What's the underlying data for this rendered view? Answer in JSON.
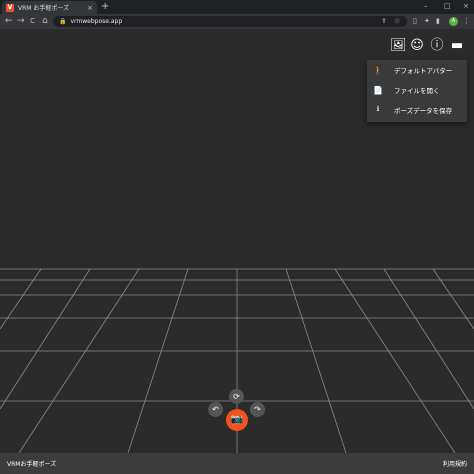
{
  "browser": {
    "tab_title": "VRM お手軽ポーズ",
    "favicon_letter": "V",
    "tab_close": "×",
    "new_tab": "+",
    "window_controls": [
      "–",
      "□",
      "×"
    ],
    "nav": {
      "back": "←",
      "forward": "→",
      "reload": "C",
      "home": "⌂"
    },
    "lock": "🔒",
    "url": "vrmwebpose.app",
    "omnibox_icons": {
      "share": "⇪",
      "star": "☆"
    },
    "toolbar_icons": {
      "bookmark": "▯",
      "extensions": "✦",
      "sidepanel": "▮",
      "menu": "⋮"
    },
    "profile_initial": "A"
  },
  "app": {
    "header_icons": {
      "image": "🖼",
      "emoji": "☺",
      "info": "ⓘ",
      "folder": "▬"
    },
    "menu": [
      {
        "icon": "🚶",
        "label": "デフォルトアバター"
      },
      {
        "icon": "📄",
        "label": "ファイルを開く"
      },
      {
        "icon": "⭳",
        "label": "ポーズデータを保存"
      }
    ],
    "fab": {
      "undo": "↶",
      "reset": "⟳",
      "redo": "↷",
      "capture": "📷"
    },
    "footer": {
      "left": "VRMお手軽ポーズ",
      "right": "利用規約"
    }
  },
  "colors": {
    "background": "#2b2b2b",
    "accent": "#f4511e",
    "grid": "#8a8a8a"
  }
}
